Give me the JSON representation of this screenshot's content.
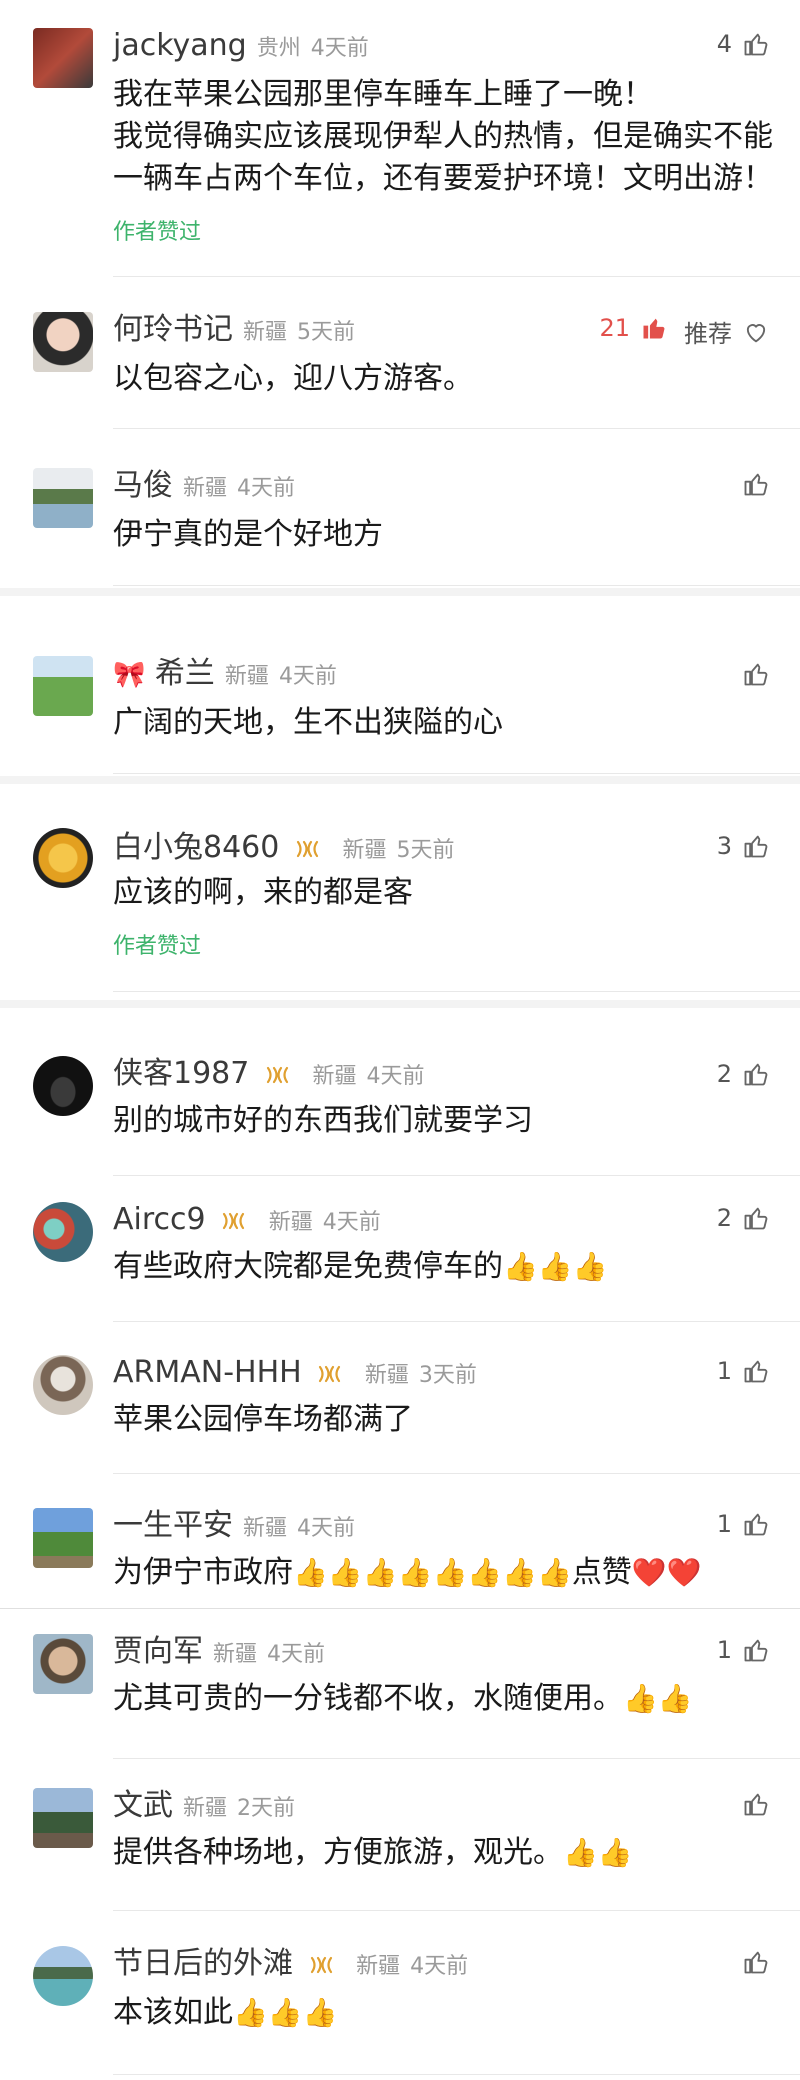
{
  "comments": [
    {
      "name": "jackyang",
      "location": "贵州",
      "time": "4天前",
      "text_lines": [
        "我在苹果公园那里停车睡车上睡了一晚！",
        "我觉得确实应该展现伊犁人的热情，但是确实不能",
        "一辆车占两个车位，还有要爱护环境！文明出游！"
      ],
      "author_liked": "作者赞过",
      "likes": "4"
    },
    {
      "name": "何玲书记",
      "location": "新疆",
      "time": "5天前",
      "text": "以包容之心，迎八方游客。",
      "likes": "21",
      "recommend": "推荐"
    },
    {
      "name": "马俊",
      "location": "新疆",
      "time": "4天前",
      "text": "伊宁真的是个好地方"
    },
    {
      "name": "希兰",
      "location": "新疆",
      "time": "4天前",
      "text": "广阔的天地，生不出狭隘的心"
    },
    {
      "name": "白小兔8460",
      "location": "新疆",
      "time": "5天前",
      "text": "应该的啊，来的都是客",
      "author_liked": "作者赞过",
      "likes": "3"
    },
    {
      "name": "侠客1987",
      "location": "新疆",
      "time": "4天前",
      "text": "别的城市好的东西我们就要学习",
      "likes": "2"
    },
    {
      "name": "Aircc9",
      "location": "新疆",
      "time": "4天前",
      "text": "有些政府大院都是免费停车的",
      "emoji": "👍👍👍",
      "likes": "2"
    },
    {
      "name": "ARMAN-HHH",
      "location": "新疆",
      "time": "3天前",
      "text": "苹果公园停车场都满了",
      "likes": "1"
    },
    {
      "name": "一生平安",
      "location": "新疆",
      "time": "4天前",
      "text": "为伊宁市政府",
      "emoji": "👍👍👍👍👍👍👍👍",
      "text2": "点赞",
      "emoji2": "❤️❤️",
      "likes": "1"
    },
    {
      "name": "贾向军",
      "location": "新疆",
      "time": "4天前",
      "text": "尤其可贵的一分钱都不收，水随便用。",
      "emoji": "👍👍",
      "likes": "1"
    },
    {
      "name": "文武",
      "location": "新疆",
      "time": "2天前",
      "text": "提供各种场地，方便旅游，观光。",
      "emoji": "👍👍"
    },
    {
      "name": "节日后的外滩",
      "location": "新疆",
      "time": "4天前",
      "text": "本该如此",
      "emoji": "👍👍👍"
    }
  ],
  "colors": {
    "accent_green": "#3db36b",
    "like_red": "#e2504b",
    "badge_gold": "#e0a030"
  }
}
